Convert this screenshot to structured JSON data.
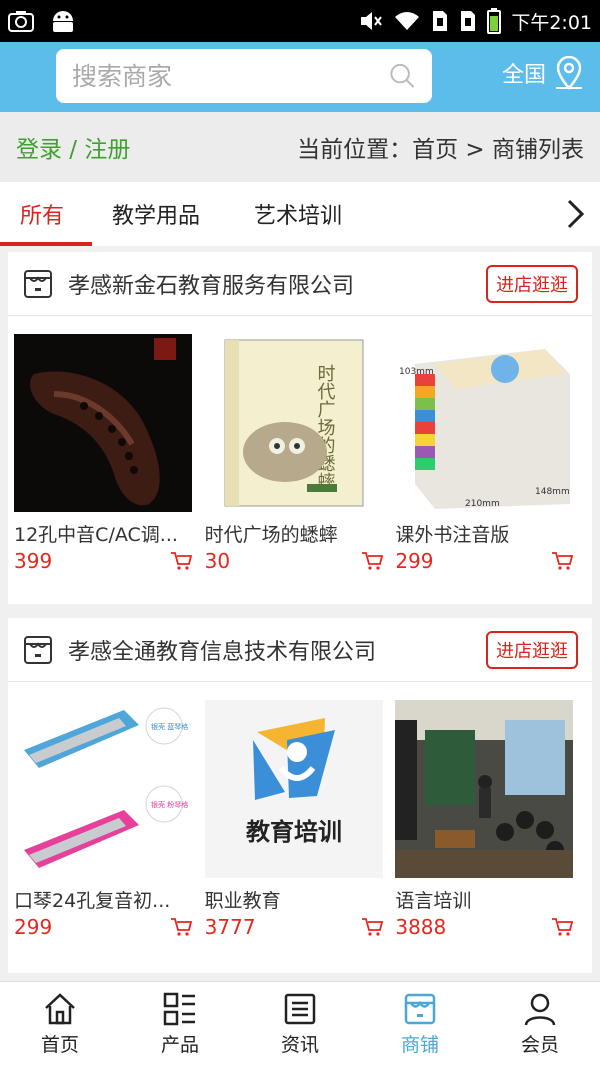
{
  "status_bar": {
    "time": "下午2:01"
  },
  "header": {
    "search_placeholder": "搜索商家",
    "region": "全国"
  },
  "breadcrumb": {
    "login": "登录 / 注册",
    "path": "当前位置：首页 > 商铺列表"
  },
  "tabs": [
    {
      "label": "所有",
      "active": true
    },
    {
      "label": "教学用品",
      "active": false
    },
    {
      "label": "艺术培训",
      "active": false
    }
  ],
  "stores": [
    {
      "name": "孝感新金石教育服务有限公司",
      "visit_label": "进店逛逛",
      "products": [
        {
          "name": "12孔中音C/AC调...",
          "price": "399"
        },
        {
          "name": "时代广场的蟋蟀",
          "price": "30",
          "cover_title": "时代广场的蟋蟀"
        },
        {
          "name": "课外书注音版",
          "price": "299",
          "dim_a": "103mm",
          "dim_b": "210mm",
          "dim_c": "148mm"
        }
      ]
    },
    {
      "name": "孝感全通教育信息技术有限公司",
      "visit_label": "进店逛逛",
      "products": [
        {
          "name": "口琴24孔复音初...",
          "price": "299",
          "tag_1": "银壳 蓝琴格",
          "tag_2": "银壳 粉琴格"
        },
        {
          "name": "职业教育",
          "price": "3777",
          "cover_text": "教育培训"
        },
        {
          "name": "语言培训",
          "price": "3888"
        }
      ]
    }
  ],
  "bottom_nav": [
    {
      "label": "首页",
      "icon": "home-icon"
    },
    {
      "label": "产品",
      "icon": "grid-list-icon"
    },
    {
      "label": "资讯",
      "icon": "news-icon"
    },
    {
      "label": "商铺",
      "icon": "store-icon",
      "active": true
    },
    {
      "label": "会员",
      "icon": "user-icon"
    }
  ],
  "colors": {
    "accent": "#5cbcea",
    "price": "#e8261d",
    "active_tab": "#d8241c",
    "login": "#3fa12f"
  }
}
